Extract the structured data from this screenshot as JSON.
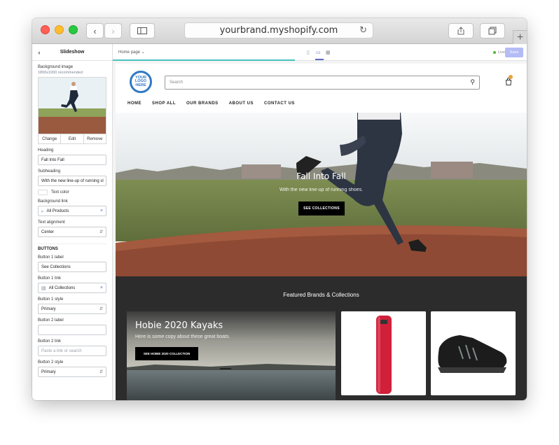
{
  "browser": {
    "url": "yourbrand.myshopify.com"
  },
  "panel": {
    "title": "Slideshow",
    "bg_image_label": "Background image",
    "bg_image_hint": "1800x1000 recommended",
    "image_actions": [
      "Change",
      "Edit",
      "Remove"
    ],
    "heading_label": "Heading",
    "heading_value": "Fall Into Fall",
    "subheading_label": "Subheading",
    "subheading_value": "With the new line-up of running sl",
    "text_color_label": "Text color",
    "bg_link_label": "Background link",
    "bg_link_value": "All Products",
    "text_align_label": "Text alignment",
    "text_align_value": "Center",
    "buttons_header": "BUTTONS",
    "b1_label_label": "Button 1 label",
    "b1_label_value": "See Collections",
    "b1_link_label": "Button 1 link",
    "b1_link_value": "All Collections",
    "b1_style_label": "Button 1 style",
    "b1_style_value": "Primary",
    "b2_label_label": "Button 2 label",
    "b2_label_value": "",
    "b2_link_label": "Button 2 link",
    "b2_link_placeholder": "Paste a link or search",
    "b2_style_label": "Button 2 style",
    "b2_style_value": "Primary"
  },
  "editor_bar": {
    "page_select": "Home page",
    "status": "Live",
    "save": "Save"
  },
  "store": {
    "logo_text": [
      "YOUR",
      "LOGO",
      "HERE"
    ],
    "search_placeholder": "Search",
    "nav": [
      "HOME",
      "SHOP ALL",
      "OUR BRANDS",
      "ABOUT US",
      "CONTACT US"
    ],
    "hero_title": "Fall Into Fall",
    "hero_subtitle": "With the new line-up of running shoes.",
    "hero_button": "SEE COLLECTIONS",
    "featured_title": "Featured Brands & Collections",
    "hobie_title": "Hobie 2020 Kayaks",
    "hobie_subtitle": "Here is some copy about these great boats.",
    "hobie_button": "SEE HOBIE 2020 COLLECTION"
  },
  "colors": {
    "accent": "#5c6ac4",
    "logo_blue": "#2f78c4",
    "progress": "#47c1bf",
    "dark_section": "#2c2c2c"
  }
}
